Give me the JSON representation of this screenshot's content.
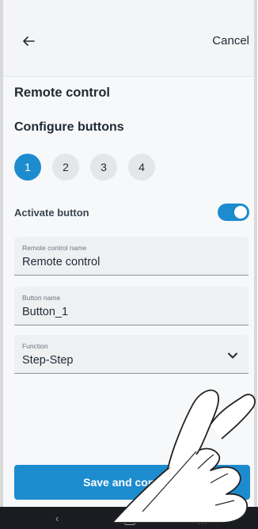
{
  "header": {
    "back_icon": "arrow-left-icon",
    "cancel_label": "Cancel"
  },
  "page": {
    "title": "Remote control",
    "subtitle": "Configure buttons"
  },
  "steps": {
    "items": [
      {
        "label": "1",
        "active": true
      },
      {
        "label": "2",
        "active": false
      },
      {
        "label": "3",
        "active": false
      },
      {
        "label": "4",
        "active": false
      }
    ]
  },
  "activate": {
    "label": "Activate button",
    "enabled": true
  },
  "fields": {
    "remote_name": {
      "label": "Remote control name",
      "value": "Remote control"
    },
    "button_name": {
      "label": "Button name",
      "value": "Button_1"
    },
    "function": {
      "label": "Function",
      "value": "Step-Step"
    }
  },
  "save_button": {
    "label": "Save and continue"
  },
  "colors": {
    "accent": "#1d8ccf",
    "header_bg": "#f4f5f6",
    "field_bg": "#eef0f2"
  },
  "system_nav": {
    "back": "‹",
    "recent": "|||"
  }
}
